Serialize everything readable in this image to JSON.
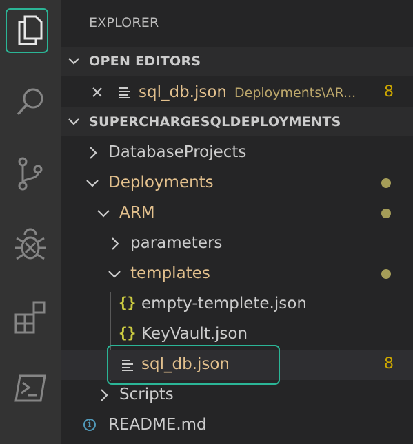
{
  "explorer": {
    "title": "EXPLORER"
  },
  "open_editors": {
    "header": "OPEN EDITORS",
    "items": [
      {
        "name": "sql_db.json",
        "path": "Deployments\\AR...",
        "badge": "8",
        "icon": "lines-icon"
      }
    ]
  },
  "workspace": {
    "header": "SUPERCHARGESQLDEPLOYMENTS",
    "tree": [
      {
        "label": "DatabaseProjects",
        "type": "folder",
        "expanded": false
      },
      {
        "label": "Deployments",
        "type": "folder",
        "expanded": true,
        "modified": true
      },
      {
        "label": "ARM",
        "type": "folder",
        "expanded": true,
        "modified": true
      },
      {
        "label": "parameters",
        "type": "folder",
        "expanded": false
      },
      {
        "label": "templates",
        "type": "folder",
        "expanded": true,
        "modified": true
      },
      {
        "label": "empty-templete.json",
        "type": "json-file"
      },
      {
        "label": "KeyVault.json",
        "type": "json-file"
      },
      {
        "label": "sql_db.json",
        "type": "file",
        "badge": "8",
        "selected": true
      },
      {
        "label": "Scripts",
        "type": "folder",
        "expanded": false
      },
      {
        "label": "README.md",
        "type": "info-file"
      }
    ]
  },
  "icons": {
    "json": "{}",
    "info": "i"
  },
  "colors": {
    "accent_highlight": "#2bb596",
    "git_modified": "#e2c08d",
    "badge": "#cca700",
    "json_icon": "#cbcb41",
    "info_icon": "#519aba"
  }
}
